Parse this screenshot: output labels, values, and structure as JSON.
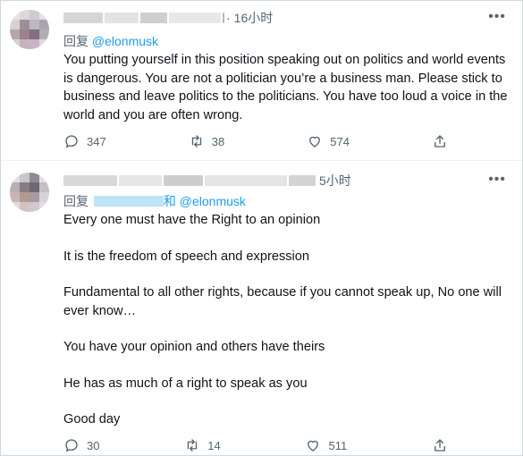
{
  "tweets": [
    {
      "time": "16小时",
      "reply_prefix": "回复",
      "reply_to": "@elonmusk",
      "reply_joiner": "",
      "text": [
        "You putting yourself in this position speaking out on politics and world events is dangerous. You are not a politician you’re a business man. Please stick to business and leave politics to the politicians. You have too loud a voice in the world and you are often wrong."
      ],
      "replies": "347",
      "retweets": "38",
      "likes": "574"
    },
    {
      "time": "5小时",
      "reply_prefix": "回复",
      "reply_joiner": "和",
      "reply_to": "@elonmusk",
      "text": [
        "Every one must have the Right to an opinion",
        "It is the freedom of speech and expression",
        "Fundamental to all other rights, because if you cannot speak up, No one will ever know…",
        "You have your opinion and others have theirs",
        "He has as much of a right to speak as you",
        "Good day"
      ],
      "replies": "30",
      "retweets": "14",
      "likes": "511"
    }
  ],
  "icons": {
    "reply": "reply-icon",
    "retweet": "retweet-icon",
    "like": "heart-icon",
    "share": "share-icon",
    "more": "more-icon"
  },
  "colors": {
    "link": "#1d9bf0",
    "muted": "#536471",
    "text": "#0f1419"
  }
}
